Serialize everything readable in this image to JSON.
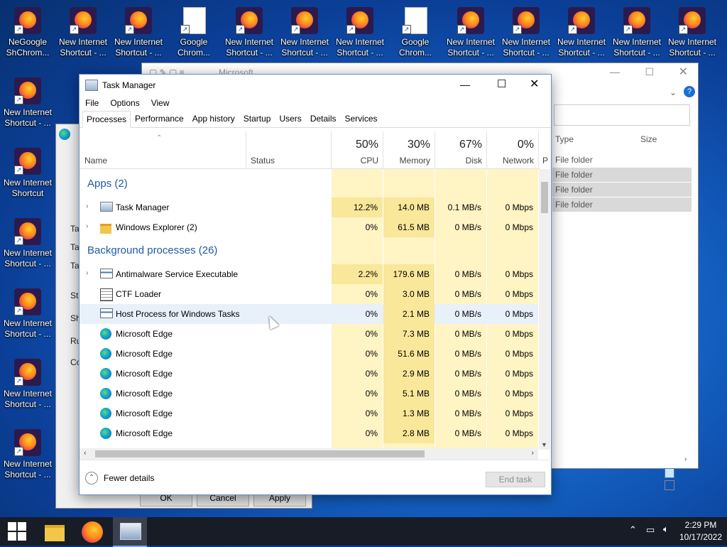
{
  "desktop": {
    "top_row": [
      {
        "label": "New Internet\nShortcut - ...",
        "kind": "ff"
      },
      {
        "label": "New Internet\nShortcut - ...",
        "kind": "ff"
      },
      {
        "label": "Google\nChrom...",
        "kind": "doc"
      },
      {
        "label": "New Internet\nShortcut - ...",
        "kind": "ff"
      },
      {
        "label": "New Internet\nShortcut - ...",
        "kind": "ff"
      },
      {
        "label": "New Internet\nShortcut - ...",
        "kind": "ff"
      },
      {
        "label": "Google\nChrom...",
        "kind": "doc"
      },
      {
        "label": "New Internet\nShortcut - ...",
        "kind": "ff"
      },
      {
        "label": "New Internet\nShortcut - ...",
        "kind": "ff"
      },
      {
        "label": "New Internet\nShortcut - ...",
        "kind": "ff"
      },
      {
        "label": "New Internet\nShortcut - ...",
        "kind": "ff"
      },
      {
        "label": "New Internet\nShortcut - ...",
        "kind": "ff"
      }
    ],
    "left_col": [
      {
        "label": "New Internet\nShortcut - ..."
      },
      {
        "label": "New Internet\nShortcut"
      },
      {
        "label": "New Internet\nShortcut - ..."
      },
      {
        "label": "New Internet\nShortcut - ..."
      },
      {
        "label": "New Internet\nShortcut - ..."
      },
      {
        "label": "New Internet\nShortcut - ..."
      }
    ],
    "overlap_label": "NeGoogle\nShChrom..."
  },
  "explorer_bg": {
    "title_fragment": "Microsoft",
    "col_type": "Type",
    "col_size": "Size",
    "rows": [
      "File folder",
      "File folder",
      "File folder",
      "File folder"
    ]
  },
  "props_bg": {
    "ok": "OK",
    "cancel": "Cancel",
    "apply": "Apply",
    "frags": [
      "Ta",
      "Ta",
      "Ta",
      "Sta",
      "Sh",
      "Ru",
      "Co"
    ]
  },
  "task_manager": {
    "title": "Task Manager",
    "menu": [
      "File",
      "Options",
      "View"
    ],
    "tabs": [
      "Processes",
      "Performance",
      "App history",
      "Startup",
      "Users",
      "Details",
      "Services"
    ],
    "active_tab": "Processes",
    "columns": {
      "name": "Name",
      "status": "Status",
      "cpu_pct": "50%",
      "cpu": "CPU",
      "mem_pct": "30%",
      "mem": "Memory",
      "disk_pct": "67%",
      "disk": "Disk",
      "net_pct": "0%",
      "net": "Network",
      "power": "P"
    },
    "groups": {
      "apps": "Apps (2)",
      "background": "Background processes (26)"
    },
    "apps": [
      {
        "name": "Task Manager",
        "cpu": "12.2%",
        "mem": "14.0 MB",
        "disk": "0.1 MB/s",
        "net": "0 Mbps",
        "icon": "taskmgr-icon"
      },
      {
        "name": "Windows Explorer (2)",
        "cpu": "0%",
        "mem": "61.5 MB",
        "disk": "0 MB/s",
        "net": "0 Mbps",
        "icon": "folder-icon"
      }
    ],
    "background": [
      {
        "name": "Antimalware Service Executable",
        "cpu": "2.2%",
        "mem": "179.6 MB",
        "disk": "0 MB/s",
        "net": "0 Mbps",
        "icon": "service-icon",
        "expand": true
      },
      {
        "name": "CTF Loader",
        "cpu": "0%",
        "mem": "3.0 MB",
        "disk": "0 MB/s",
        "net": "0 Mbps",
        "icon": "ctf-icon",
        "expand": false
      },
      {
        "name": "Host Process for Windows Tasks",
        "cpu": "0%",
        "mem": "2.1 MB",
        "disk": "0 MB/s",
        "net": "0 Mbps",
        "icon": "service-icon",
        "expand": false
      },
      {
        "name": "Microsoft Edge",
        "cpu": "0%",
        "mem": "7.3 MB",
        "disk": "0 MB/s",
        "net": "0 Mbps",
        "icon": "edge-icon",
        "expand": false
      },
      {
        "name": "Microsoft Edge",
        "cpu": "0%",
        "mem": "51.6 MB",
        "disk": "0 MB/s",
        "net": "0 Mbps",
        "icon": "edge-icon",
        "expand": false
      },
      {
        "name": "Microsoft Edge",
        "cpu": "0%",
        "mem": "2.9 MB",
        "disk": "0 MB/s",
        "net": "0 Mbps",
        "icon": "edge-icon",
        "expand": false
      },
      {
        "name": "Microsoft Edge",
        "cpu": "0%",
        "mem": "5.1 MB",
        "disk": "0 MB/s",
        "net": "0 Mbps",
        "icon": "edge-icon",
        "expand": false
      },
      {
        "name": "Microsoft Edge",
        "cpu": "0%",
        "mem": "1.3 MB",
        "disk": "0 MB/s",
        "net": "0 Mbps",
        "icon": "edge-icon",
        "expand": false
      },
      {
        "name": "Microsoft Edge",
        "cpu": "0%",
        "mem": "2.8 MB",
        "disk": "0 MB/s",
        "net": "0 Mbps",
        "icon": "edge-icon",
        "expand": false
      }
    ],
    "fewer_details": "Fewer details",
    "end_task": "End task"
  },
  "taskbar": {
    "time": "2:29 PM",
    "date": "10/17/2022"
  },
  "colors": {
    "heat_high": "#f9e79a",
    "heat_low": "#fff4c4",
    "group_blue": "#1f5aa6",
    "taskbar_bg": "#171c26"
  }
}
